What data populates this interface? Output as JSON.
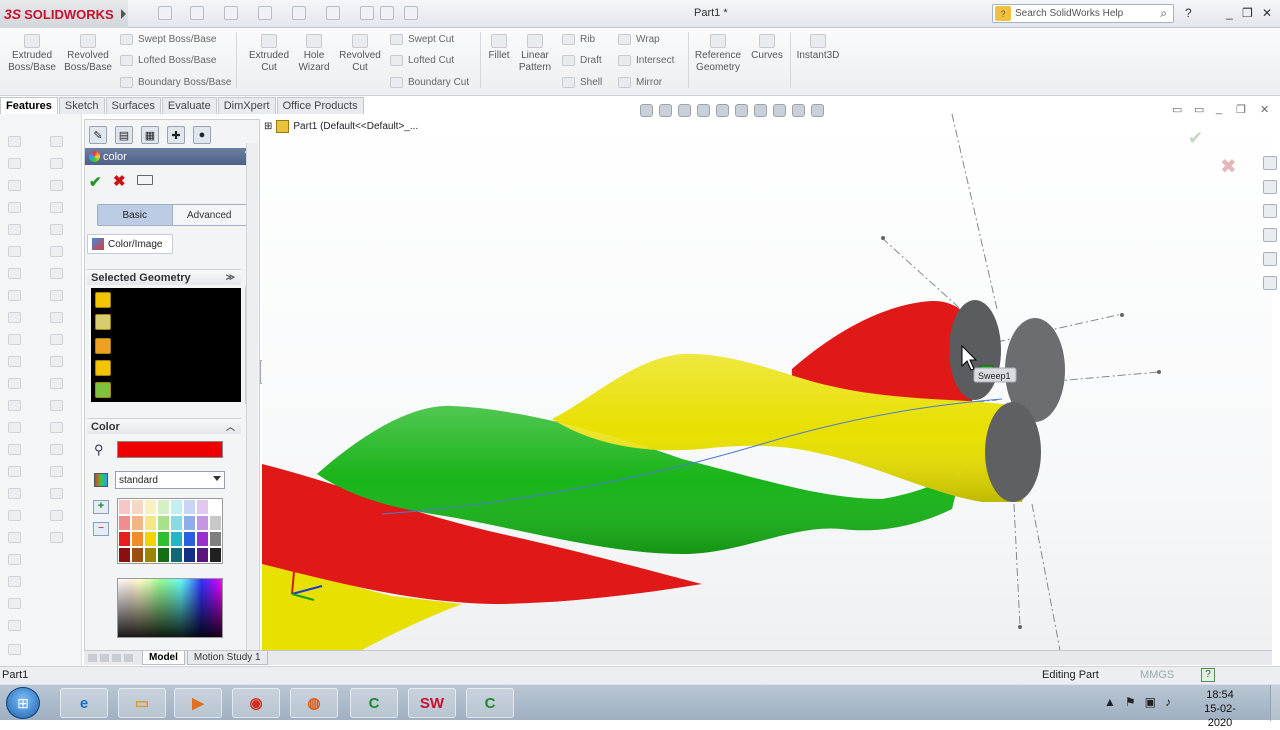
{
  "app": {
    "logo": "SOLIDWORKS",
    "logo_prefix": "3S",
    "document_title": "Part1 *",
    "search_placeholder": "Search SolidWorks Help"
  },
  "command_manager": {
    "big_buttons": [
      "Extruded Boss/Base",
      "Revolved Boss/Base",
      "Extruded Cut",
      "Hole Wizard",
      "Revolved Cut",
      "Fillet",
      "Linear Pattern",
      "Reference Geometry",
      "Curves",
      "Instant3D"
    ],
    "small_buttons": [
      "Swept Boss/Base",
      "Lofted Boss/Base",
      "Boundary Boss/Base",
      "Swept Cut",
      "Lofted Cut",
      "Boundary Cut",
      "Rib",
      "Draft",
      "Shell",
      "Wrap",
      "Intersect",
      "Mirror"
    ]
  },
  "tabs": [
    "Features",
    "Sketch",
    "Surfaces",
    "Evaluate",
    "DimXpert",
    "Office Products"
  ],
  "active_tab": "Features",
  "property_manager": {
    "title": "color",
    "help": "?",
    "mode_basic": "Basic",
    "mode_advanced": "Advanced",
    "subtab": "Color/Image",
    "selected_geometry_header": "Selected Geometry",
    "color_header": "Color",
    "current_color": "#ee0000",
    "palette_value": "standard",
    "palette_swatches": [
      "#f7c7c7",
      "#f7d8c2",
      "#f9f2c0",
      "#d5f0c5",
      "#c4eef2",
      "#c7d6f5",
      "#e2c8f0",
      "#ffffff",
      "#ef8e8e",
      "#f3b583",
      "#f5e68a",
      "#a9e18a",
      "#86dbe5",
      "#8ead eb",
      "#c596e1",
      "#c8c8c8",
      "#e61e1e",
      "#f08a2a",
      "#f4d400",
      "#2fc02f",
      "#23b6c8",
      "#2a5fe0",
      "#9a2fd0",
      "#808080",
      "#8a0f0f",
      "#9e4f10",
      "#9a8500",
      "#156e15",
      "#0d6a76",
      "#142f86",
      "#5a167e",
      "#202020"
    ]
  },
  "viewport": {
    "tree_root": "Part1  (Default<<Default>_...",
    "sketch_tooltip": "Sweep1"
  },
  "motion_tabs": [
    "Model",
    "Motion Study 1"
  ],
  "status": {
    "left": "Part1",
    "mode": "Editing Part",
    "units": "MMGS"
  },
  "taskbar": {
    "time": "18:54",
    "date": "15-02-2020"
  },
  "colors": {
    "red_strand": "#e01818",
    "yellow_strand": "#e8e000",
    "green_strand": "#18b418"
  }
}
